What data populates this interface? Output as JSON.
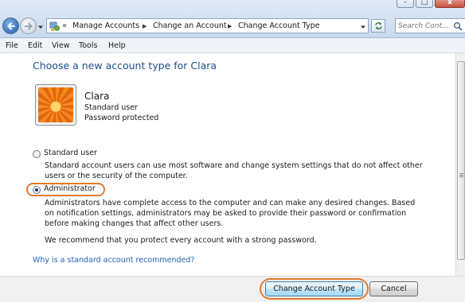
{
  "window": {
    "controls": {
      "minimize": "–",
      "maximize": "□",
      "close": "x"
    }
  },
  "toolbar": {
    "back_icon": "back-arrow-icon",
    "forward_icon": "forward-arrow-icon",
    "breadcrumb_overflow": "«",
    "breadcrumbs": [
      "Manage Accounts",
      "Change an Account",
      "Change Account Type"
    ],
    "search_placeholder": "Search Cont..."
  },
  "menu": [
    "File",
    "Edit",
    "View",
    "Tools",
    "Help"
  ],
  "main": {
    "title": "Choose a new account type for Clara",
    "user": {
      "name": "Clara",
      "type": "Standard user",
      "protection": "Password protected"
    },
    "options": [
      {
        "label": "Standard user",
        "selected": false,
        "description": "Standard account users can use most software and change system settings that do not affect other users or the security of the computer."
      },
      {
        "label": "Administrator",
        "selected": true,
        "description": "Administrators have complete access to the computer and can make any desired changes. Based on notification settings, administrators may be asked to provide their password or confirmation before making changes that affect other users."
      }
    ],
    "recommendation": "We recommend that you protect every account with a strong password.",
    "help_link": "Why is a standard account recommended?"
  },
  "footer": {
    "primary_button": "Change Account Type",
    "cancel_button": "Cancel"
  },
  "colors": {
    "title": "#1e4e8c",
    "link": "#2463b0",
    "highlight": "#e07a2a"
  }
}
